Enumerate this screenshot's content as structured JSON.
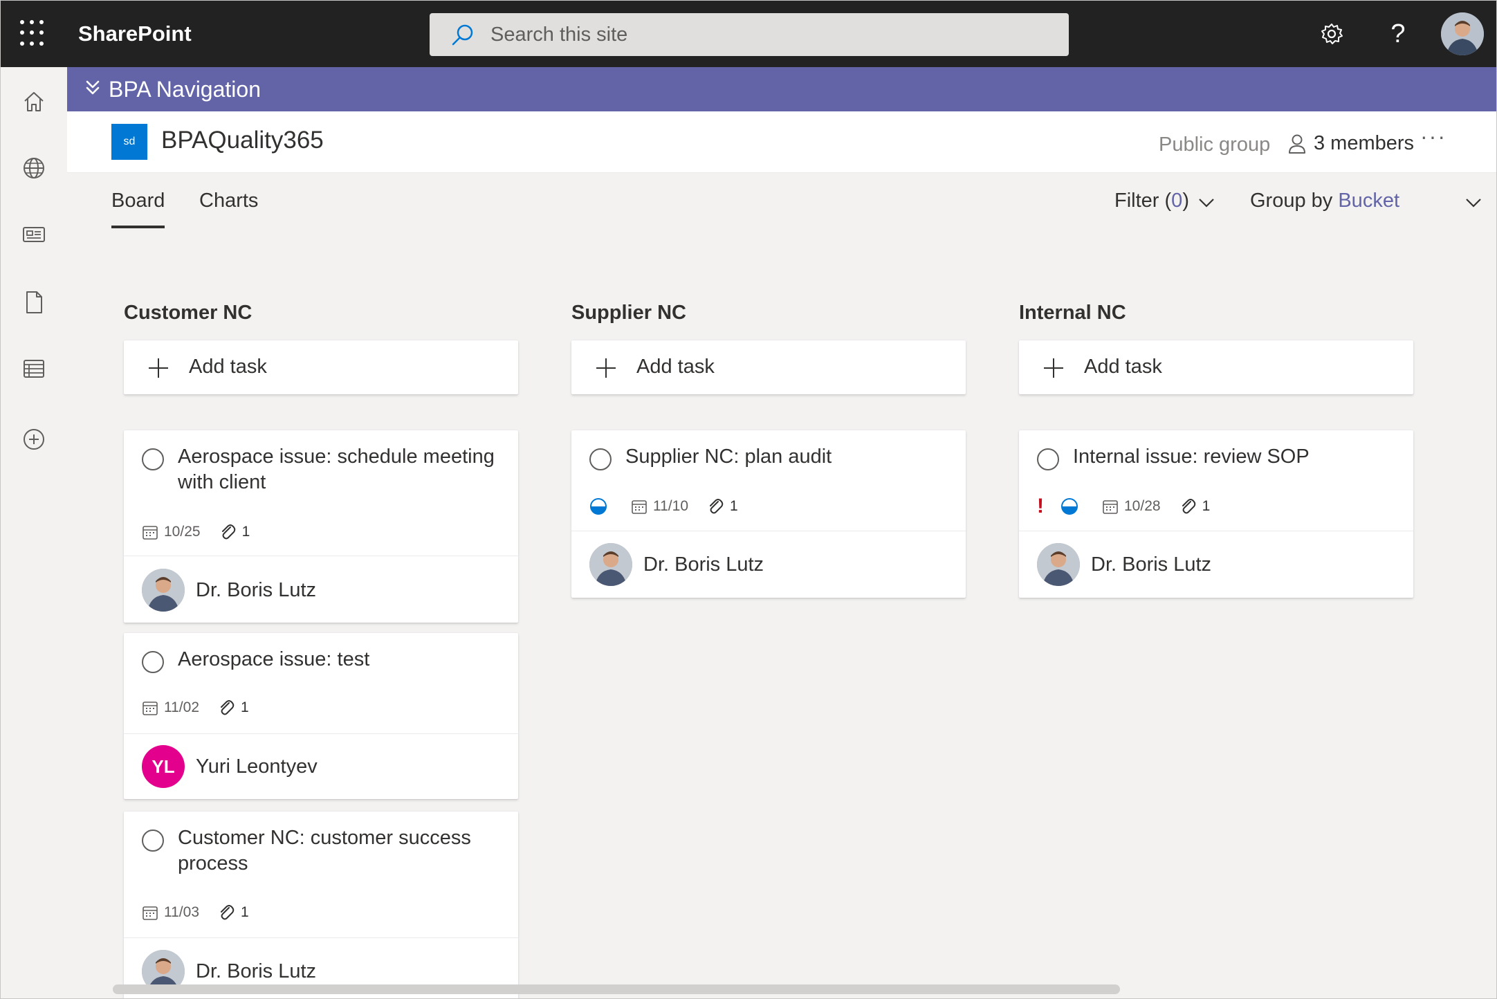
{
  "app": {
    "brand": "SharePoint"
  },
  "search": {
    "placeholder": "Search this site"
  },
  "hub": {
    "title": "BPA Navigation"
  },
  "site": {
    "logo_text": "sd",
    "title": "BPAQuality365",
    "privacy": "Public group",
    "members": "3 members",
    "more": "···"
  },
  "tabs": [
    {
      "label": "Board",
      "active": true
    },
    {
      "label": "Charts",
      "active": false
    }
  ],
  "filter": {
    "label": "Filter (",
    "count": "0",
    "close": ")"
  },
  "groupby": {
    "label": "Group by ",
    "value": "Bucket"
  },
  "buckets": [
    {
      "name": "Customer NC",
      "add_label": "Add task",
      "cards": [
        {
          "title": "Aerospace issue: schedule meeting with client",
          "due": "10/25",
          "attachments": "1",
          "assignee": "Dr. Boris Lutz"
        },
        {
          "title": "Aerospace issue: test",
          "due": "11/02",
          "attachments": "1",
          "assignee": "Yuri Leontyev",
          "initials": "YL"
        },
        {
          "title": "Customer NC: customer success process",
          "due": "11/03",
          "attachments": "1",
          "assignee": "Dr. Boris Lutz"
        }
      ]
    },
    {
      "name": "Supplier NC",
      "add_label": "Add task",
      "cards": [
        {
          "title": "Supplier NC: plan audit",
          "due": "11/10",
          "attachments": "1",
          "assignee": "Dr. Boris Lutz",
          "progress": "in-progress"
        }
      ]
    },
    {
      "name": "Internal NC",
      "add_label": "Add task",
      "cards": [
        {
          "title": "Internal issue: review SOP",
          "due": "10/28",
          "attachments": "1",
          "assignee": "Dr. Boris Lutz",
          "priority": "!",
          "progress": "in-progress"
        }
      ]
    }
  ],
  "colors": {
    "suite": "#222222",
    "hub": "#6264a7",
    "accent": "#0078d4",
    "yl_avatar": "#e3008c",
    "urgent": "#c50f1f"
  }
}
